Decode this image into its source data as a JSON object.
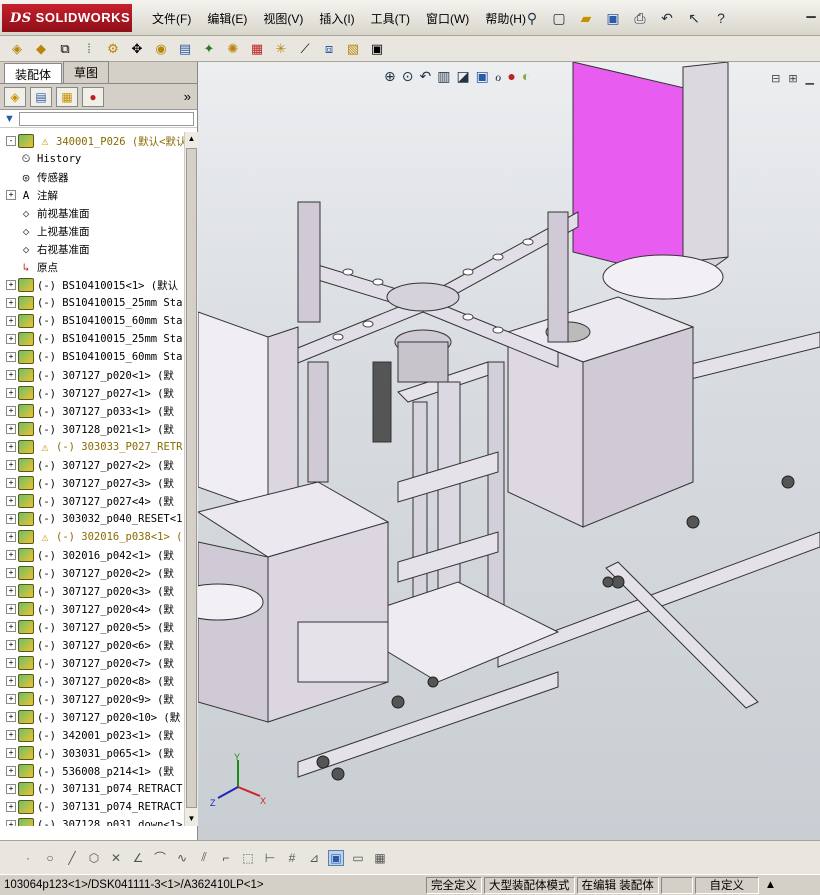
{
  "app": {
    "logo_prefix": "DS",
    "logo_text": "SOLIDWORKS"
  },
  "menu": [
    "文件(F)",
    "编辑(E)",
    "视图(V)",
    "插入(I)",
    "工具(T)",
    "窗口(W)",
    "帮助(H)"
  ],
  "panel": {
    "tabs": [
      "装配体",
      "草图"
    ],
    "tree": [
      {
        "icon": "asm-warn",
        "text": "340001_P026  (默认<默认_",
        "expand": "-",
        "cls": "top"
      },
      {
        "icon": "history",
        "text": "History",
        "expand": ""
      },
      {
        "icon": "sensor",
        "text": "传感器",
        "expand": ""
      },
      {
        "icon": "annot",
        "text": "注解",
        "expand": "+"
      },
      {
        "icon": "plane",
        "text": "前视基准面",
        "expand": ""
      },
      {
        "icon": "plane",
        "text": "上视基准面",
        "expand": ""
      },
      {
        "icon": "plane",
        "text": "右视基准面",
        "expand": ""
      },
      {
        "icon": "origin",
        "text": "原点",
        "expand": ""
      },
      {
        "icon": "asm",
        "text": "(-) BS10410015<1> (默认",
        "expand": "+"
      },
      {
        "icon": "asm",
        "text": "(-) BS10410015_25mm Sta",
        "expand": "+"
      },
      {
        "icon": "asm",
        "text": "(-) BS10410015_60mm Sta",
        "expand": "+"
      },
      {
        "icon": "asm",
        "text": "(-) BS10410015_25mm Sta",
        "expand": "+"
      },
      {
        "icon": "asm",
        "text": "(-) BS10410015_60mm Sta",
        "expand": "+"
      },
      {
        "icon": "asm",
        "text": "(-) 307127_p020<1> (默",
        "expand": "+"
      },
      {
        "icon": "asm",
        "text": "(-) 307127_p027<1> (默",
        "expand": "+"
      },
      {
        "icon": "asm",
        "text": "(-) 307127_p033<1> (默",
        "expand": "+"
      },
      {
        "icon": "asm",
        "text": "(-) 307128_p021<1> (默",
        "expand": "+"
      },
      {
        "icon": "asm-warn",
        "text": "(-) 303033_P027_RETR",
        "expand": "+",
        "cls": "w"
      },
      {
        "icon": "asm",
        "text": "(-) 307127_p027<2> (默",
        "expand": "+"
      },
      {
        "icon": "asm",
        "text": "(-) 307127_p027<3> (默",
        "expand": "+"
      },
      {
        "icon": "asm",
        "text": "(-) 307127_p027<4> (默",
        "expand": "+"
      },
      {
        "icon": "asm",
        "text": "(-) 303032_p040_RESET<1",
        "expand": "+"
      },
      {
        "icon": "asm-warn",
        "text": "(-) 302016_p038<1> (",
        "expand": "+",
        "cls": "w"
      },
      {
        "icon": "asm",
        "text": "(-) 302016_p042<1> (默",
        "expand": "+"
      },
      {
        "icon": "asm",
        "text": "(-) 307127_p020<2> (默",
        "expand": "+"
      },
      {
        "icon": "asm",
        "text": "(-) 307127_p020<3> (默",
        "expand": "+"
      },
      {
        "icon": "asm",
        "text": "(-) 307127_p020<4> (默",
        "expand": "+"
      },
      {
        "icon": "asm",
        "text": "(-) 307127_p020<5> (默",
        "expand": "+"
      },
      {
        "icon": "asm",
        "text": "(-) 307127_p020<6> (默",
        "expand": "+"
      },
      {
        "icon": "asm",
        "text": "(-) 307127_p020<7> (默",
        "expand": "+"
      },
      {
        "icon": "asm",
        "text": "(-) 307127_p020<8> (默",
        "expand": "+"
      },
      {
        "icon": "asm",
        "text": "(-) 307127_p020<9> (默",
        "expand": "+"
      },
      {
        "icon": "asm",
        "text": "(-) 307127_p020<10> (默",
        "expand": "+"
      },
      {
        "icon": "asm",
        "text": "(-) 342001_p023<1> (默",
        "expand": "+"
      },
      {
        "icon": "asm",
        "text": "(-) 303031_p065<1> (默",
        "expand": "+"
      },
      {
        "icon": "asm",
        "text": "(-) 536008_p214<1> (默",
        "expand": "+"
      },
      {
        "icon": "asm",
        "text": "(-) 307131_p074_RETRACT",
        "expand": "+"
      },
      {
        "icon": "asm",
        "text": "(-) 307131_p074_RETRACT",
        "expand": "+"
      },
      {
        "icon": "asm",
        "text": "(-) 307128_p031_down<1>",
        "expand": "+"
      }
    ]
  },
  "status": {
    "path": "103064p123<1>/DSK041111-3<1>/A362410LP<1>",
    "definition": "完全定义",
    "mode": "大型装配体模式",
    "editing": "在编辑 装配体",
    "units": "自定义"
  },
  "colors": {
    "accent_magenta": "#e05ce8",
    "viewport_bg": "#d8dce0",
    "logo_red": "#c8202e"
  }
}
